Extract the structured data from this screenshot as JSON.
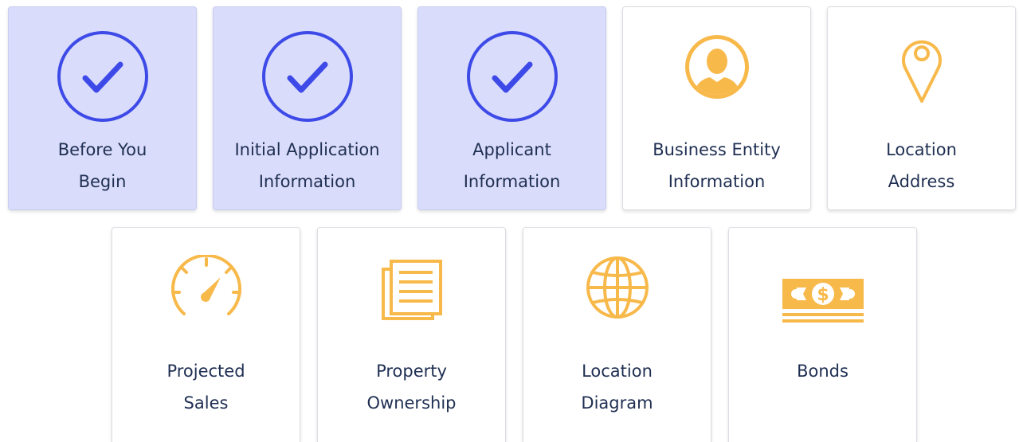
{
  "colors": {
    "complete_bg": "#d9dcfa",
    "complete_icon": "#3d4ae8",
    "pending_icon": "#f8b94b",
    "label_text": "#1f2f52"
  },
  "steps": [
    {
      "line1": "Before You",
      "line2": "Begin",
      "icon": "check-circle-icon",
      "status": "complete"
    },
    {
      "line1": "Initial Application",
      "line2": "Information",
      "icon": "check-circle-icon",
      "status": "complete"
    },
    {
      "line1": "Applicant",
      "line2": "Information",
      "icon": "check-circle-icon",
      "status": "complete"
    },
    {
      "line1": "Business Entity",
      "line2": "Information",
      "icon": "person-avatar-icon",
      "status": "pending"
    },
    {
      "line1": "Location",
      "line2": "Address",
      "icon": "map-pin-icon",
      "status": "pending"
    },
    {
      "line1": "Projected",
      "line2": "Sales",
      "icon": "speedometer-icon",
      "status": "pending"
    },
    {
      "line1": "Property",
      "line2": "Ownership",
      "icon": "document-icon",
      "status": "pending"
    },
    {
      "line1": "Location",
      "line2": "Diagram",
      "icon": "globe-icon",
      "status": "pending"
    },
    {
      "line1": "Bonds",
      "line2": "",
      "icon": "money-bill-icon",
      "status": "pending"
    }
  ]
}
